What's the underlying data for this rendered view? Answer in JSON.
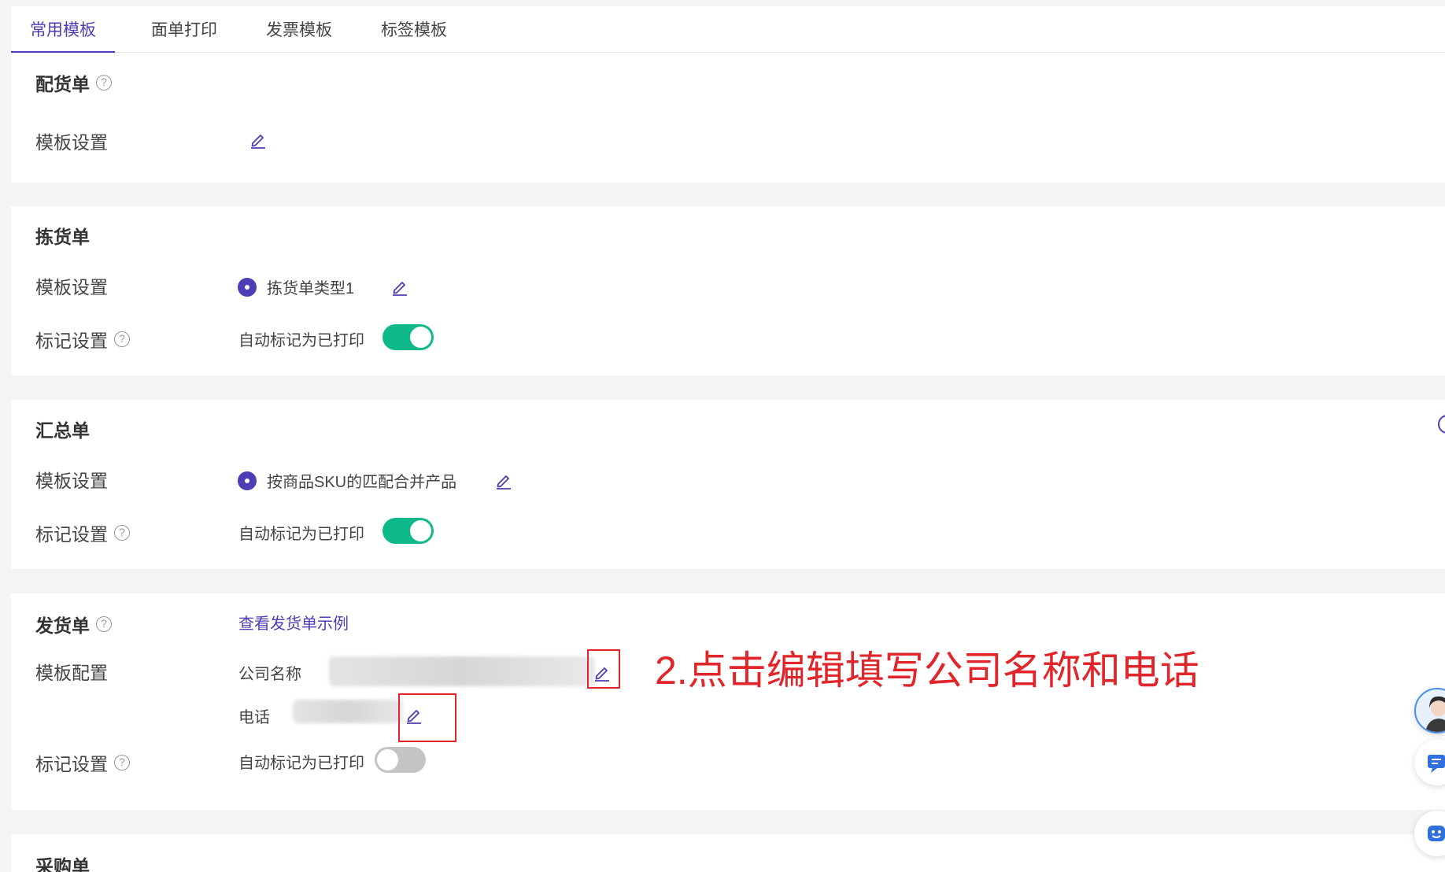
{
  "tabs": [
    {
      "label": "常用模板",
      "active": true
    },
    {
      "label": "面单打印",
      "active": false
    },
    {
      "label": "发票模板",
      "active": false
    },
    {
      "label": "标签模板",
      "active": false
    }
  ],
  "peihuo": {
    "title": "配货单",
    "template_label": "模板设置"
  },
  "jianhuo": {
    "title": "拣货单",
    "template_label": "模板设置",
    "template_option": "拣货单类型1",
    "mark_label": "标记设置",
    "mark_text": "自动标记为已打印",
    "mark_on": true
  },
  "huizong": {
    "title": "汇总单",
    "template_label": "模板设置",
    "template_option": "按商品SKU的匹配合并产品",
    "mark_label": "标记设置",
    "mark_text": "自动标记为已打印",
    "mark_on": true
  },
  "fahuo": {
    "title": "发货单",
    "example_link": "查看发货单示例",
    "template_label": "模板配置",
    "company_label": "公司名称",
    "phone_label": "电话",
    "mark_label": "标记设置",
    "mark_text": "自动标记为已打印",
    "mark_on": false
  },
  "caigou": {
    "title": "采购单"
  },
  "annotation": "2.点击编辑填写公司名称和电话",
  "help_glyph": "?",
  "colors": {
    "accent": "#4c3eb4",
    "switch_on": "#10b98a",
    "switch_off": "#c4c4c4",
    "annotation_red": "#e0252b"
  }
}
